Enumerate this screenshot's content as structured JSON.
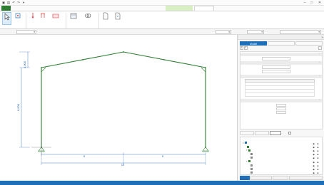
{
  "window": {
    "title": "",
    "min_glyph": "–",
    "max_glyph": "□",
    "close_glyph": "✕"
  },
  "ribbon": {
    "tabs": [
      "",
      "",
      "",
      "",
      "",
      "",
      "",
      "",
      "",
      "",
      "",
      ""
    ],
    "active_tab_index": 11,
    "context_tab_index": 10,
    "buttons": [
      "",
      "",
      "",
      "",
      "",
      "",
      "",
      "",
      "",
      "",
      ""
    ],
    "groups": [
      "",
      "",
      "",
      "",
      "",
      ""
    ]
  },
  "optionbar": {
    "label_left": "",
    "value_left": "",
    "label_mid": "",
    "value_mid": "",
    "label_right1": "",
    "value_right1": "",
    "label_right2": "",
    "value_right2": ""
  },
  "drawing": {
    "dim_height_left": "4,000",
    "dim_height_total": "6,000",
    "dim_span_left": "5",
    "dim_span_right": "5",
    "dim_total_span": "12",
    "roof_label_1": "",
    "roof_label_2": "",
    "roof_label_3": "",
    "roof_label_4": "",
    "roof_label_5": "",
    "support_label": "",
    "crosshair_label": ""
  },
  "properties_panel": {
    "title": "",
    "tabs": [
      "Modell",
      "",
      ""
    ],
    "sections": {
      "general": "",
      "name": "",
      "material": "",
      "dimensions": ""
    },
    "fields": [
      {
        "key": "",
        "value": ""
      },
      {
        "key": "",
        "value": ""
      },
      {
        "key": "",
        "value": ""
      }
    ],
    "material_table": {
      "headers": [
        "",
        ""
      ],
      "rows": [
        [
          "",
          ""
        ],
        [
          "",
          ""
        ],
        [
          "",
          ""
        ],
        [
          "",
          ""
        ]
      ]
    },
    "dimensions": [
      {
        "key": "",
        "value": "",
        "unit": ""
      },
      {
        "key": "",
        "value": "",
        "unit": ""
      },
      {
        "key": "",
        "value": "",
        "unit": ""
      }
    ]
  },
  "filterbar": {
    "buttons": [
      "",
      "",
      ""
    ],
    "checkbox_label": ""
  },
  "tree": {
    "title": "",
    "items": [
      {
        "label": "",
        "level": 0,
        "expander": "▾"
      },
      {
        "label": "",
        "level": 1,
        "expander": ""
      },
      {
        "label": "",
        "level": 1,
        "expander": "▾"
      },
      {
        "label": "",
        "level": 2,
        "expander": ""
      },
      {
        "label": "",
        "level": 2,
        "expander": ""
      },
      {
        "label": "",
        "level": 1,
        "expander": "▾"
      },
      {
        "label": "",
        "level": 2,
        "expander": ""
      },
      {
        "label": "",
        "level": 2,
        "expander": ""
      },
      {
        "label": "",
        "level": 2,
        "expander": ""
      }
    ]
  },
  "bottom_tabs": [
    "",
    "",
    "",
    ""
  ],
  "statusbar": {
    "left": "",
    "right": ""
  },
  "colors": {
    "accent": "#1f6fb8",
    "file_tab": "#2e7d32",
    "frame_green": "#2e7d32",
    "dim_blue": "#1f5fa8"
  }
}
